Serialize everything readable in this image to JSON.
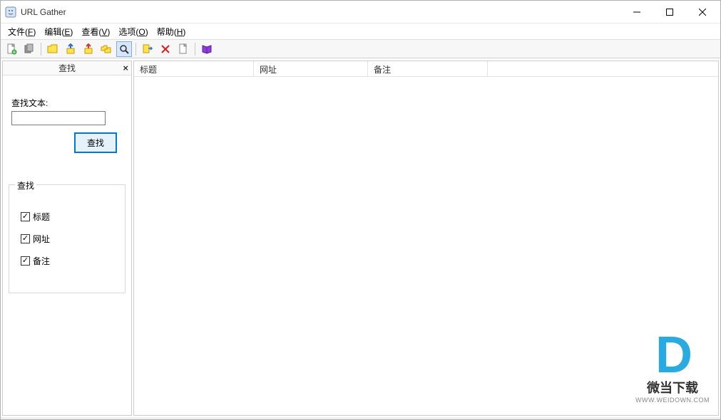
{
  "window": {
    "title": "URL Gather"
  },
  "menu": {
    "file": "文件(F)",
    "edit": "编辑(E)",
    "view": "查看(V)",
    "options": "选项(O)",
    "help": "帮助(H)"
  },
  "toolbar_icons": [
    "new-doc-icon",
    "copy-icon",
    "folder-yellow-icon",
    "extract-blue-icon",
    "extract-red-icon",
    "folders-icon",
    "find-magnifier-icon",
    "export-icon",
    "delete-x-icon",
    "page-icon",
    "book-icon"
  ],
  "sidebar": {
    "title": "查找",
    "close": "×",
    "search_label": "查找文本:",
    "search_value": "",
    "search_button": "查找",
    "group_title": "查找",
    "checks": [
      {
        "label": "标题",
        "checked": true
      },
      {
        "label": "网址",
        "checked": true
      },
      {
        "label": "备注",
        "checked": true
      }
    ]
  },
  "list": {
    "columns": [
      "标题",
      "网址",
      "备注"
    ]
  },
  "watermark": {
    "line1": "微当下载",
    "line2": "WWW.WEIDOWN.COM"
  }
}
